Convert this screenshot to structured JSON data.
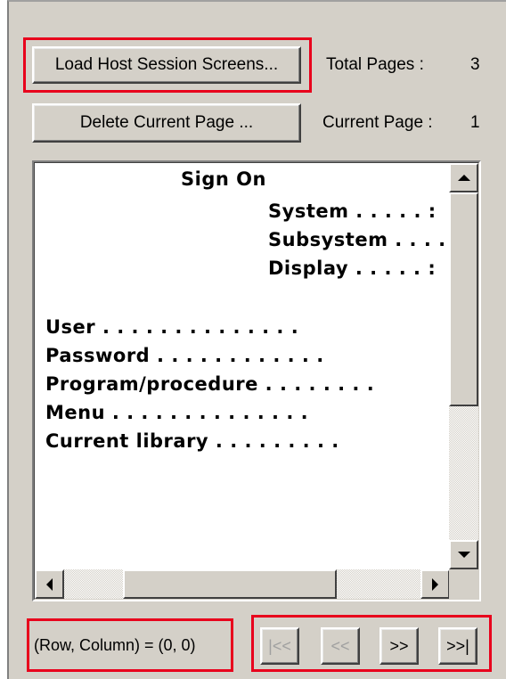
{
  "buttons": {
    "load": "Load Host Session Screens...",
    "delete": "Delete Current Page ..."
  },
  "info": {
    "total_pages_label": "Total Pages :",
    "total_pages_value": "3",
    "current_page_label": "Current Page :",
    "current_page_value": "1"
  },
  "screen": {
    "lines": [
      "Sign On",
      "System . . . . . :",
      "Subsystem . . . .",
      "Display . . . . . :",
      "User . . . . . . . . . . . . . .",
      "Password . . . . . . . . . . . .",
      "Program/procedure . . . . . . . .",
      "Menu . . . . . . . . . . . . . .",
      "Current library . . . . . . . . ."
    ]
  },
  "status": {
    "row_column": "(Row, Column) =  (0, 0)"
  },
  "nav": {
    "first": "|<<",
    "prev": "<<",
    "next": ">>",
    "last": ">>|"
  },
  "colors": {
    "highlight": "#e8001c",
    "window_bg": "#d4d0c8"
  }
}
